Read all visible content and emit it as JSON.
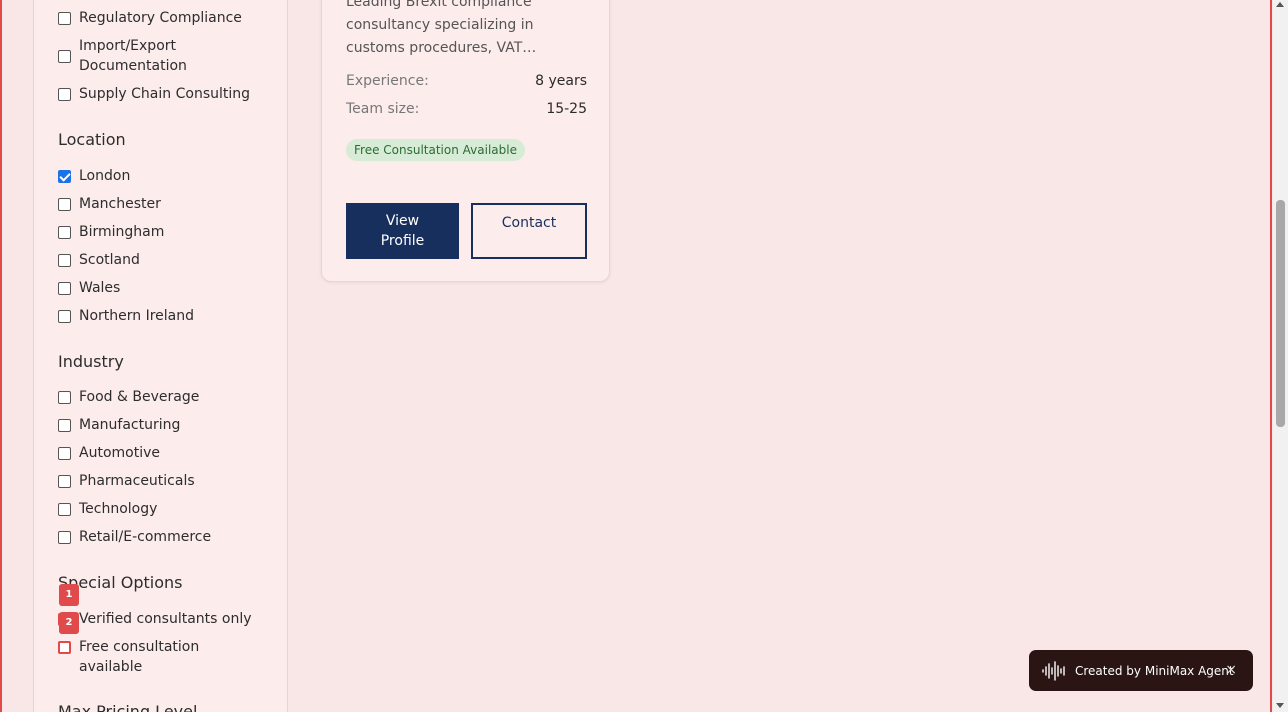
{
  "sidebar": {
    "service_items": [
      {
        "label": "Regulatory Compliance",
        "checked": false
      },
      {
        "label": "Import/Export Documentation",
        "checked": false
      },
      {
        "label": "Supply Chain Consulting",
        "checked": false
      }
    ],
    "location_title": "Location",
    "location_items": [
      {
        "label": "London",
        "checked": true
      },
      {
        "label": "Manchester",
        "checked": false
      },
      {
        "label": "Birmingham",
        "checked": false
      },
      {
        "label": "Scotland",
        "checked": false
      },
      {
        "label": "Wales",
        "checked": false
      },
      {
        "label": "Northern Ireland",
        "checked": false
      }
    ],
    "industry_title": "Industry",
    "industry_items": [
      {
        "label": "Food & Beverage",
        "checked": false
      },
      {
        "label": "Manufacturing",
        "checked": false
      },
      {
        "label": "Automotive",
        "checked": false
      },
      {
        "label": "Pharmaceuticals",
        "checked": false
      },
      {
        "label": "Technology",
        "checked": false
      },
      {
        "label": "Retail/E-commerce",
        "checked": false
      }
    ],
    "special_title": "Special Options",
    "special_items": [
      {
        "label": "Verified consultants only",
        "checked": false,
        "badge": "1"
      },
      {
        "label": "Free consultation available",
        "checked": false,
        "badge": "2"
      }
    ],
    "pricing_title": "Max Pricing Level"
  },
  "card": {
    "description": "Leading Brexit compliance consultancy specializing in customs procedures, VAT…",
    "experience_label": "Experience:",
    "experience_value": "8 years",
    "team_label": "Team size:",
    "team_value": "15-25",
    "tag": "Free Consultation Available",
    "view_profile": "View Profile",
    "contact": "Contact"
  },
  "toast": {
    "text": "Created by MiniMax Agent",
    "close": "×",
    "icon": "waveform-icon"
  },
  "colors": {
    "background": "#f9e6e6",
    "primary": "#172f5c",
    "tag_bg": "#d7ecd6",
    "badge": "#e04a4a"
  }
}
